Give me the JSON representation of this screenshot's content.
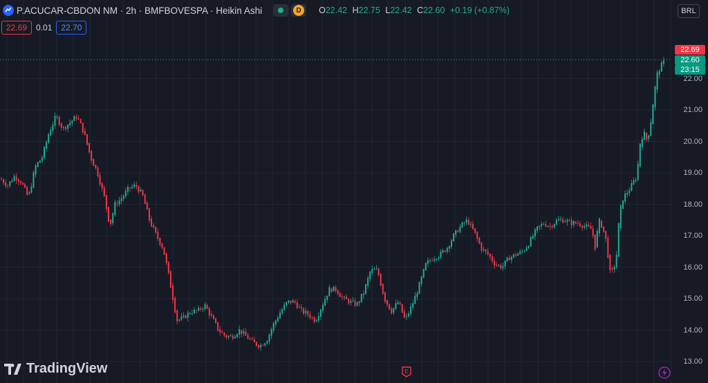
{
  "header": {
    "symbol": "P.ACUCAR-CBDON NM · 2h · BMFBOVESPA · Heikin Ashi",
    "badge_letter": "D",
    "ohlc": {
      "o_label": "O",
      "o": "22.42",
      "h_label": "H",
      "h": "22.75",
      "l_label": "L",
      "l": "22.42",
      "c_label": "C",
      "c": "22.60",
      "change": "+0.19 (+0.87%)"
    }
  },
  "order_row": {
    "sell": "22.69",
    "spread": "0.01",
    "buy": "22.70"
  },
  "currency": "BRL",
  "price_axis": {
    "ticks": [
      "22.00",
      "21.00",
      "20.00",
      "19.00",
      "18.00",
      "17.00",
      "16.00",
      "15.00",
      "14.00",
      "13.00"
    ],
    "tag_ask": "22.69",
    "tag_last": "22.60",
    "tag_countdown": "23:15"
  },
  "logo_text": "TradingView",
  "earnings_marker": "E",
  "colors": {
    "up": "#22ab94",
    "down": "#f23645",
    "background": "#161a25",
    "grid": "#232632"
  },
  "chart_data": {
    "type": "candlestick",
    "title": "",
    "ylim": [
      13.0,
      23.0
    ],
    "keypoints": [
      [
        0,
        18.8
      ],
      [
        10,
        18.6
      ],
      [
        20,
        18.9
      ],
      [
        30,
        18.7
      ],
      [
        40,
        18.2
      ],
      [
        50,
        19.2
      ],
      [
        60,
        19.5
      ],
      [
        70,
        20.3
      ],
      [
        80,
        20.8
      ],
      [
        90,
        20.4
      ],
      [
        100,
        20.6
      ],
      [
        110,
        20.8
      ],
      [
        120,
        20.3
      ],
      [
        130,
        19.5
      ],
      [
        140,
        19.0
      ],
      [
        150,
        18.2
      ],
      [
        158,
        17.3
      ],
      [
        165,
        18.0
      ],
      [
        175,
        18.2
      ],
      [
        185,
        18.5
      ],
      [
        195,
        18.6
      ],
      [
        205,
        18.3
      ],
      [
        215,
        17.5
      ],
      [
        225,
        17.0
      ],
      [
        235,
        16.6
      ],
      [
        245,
        15.5
      ],
      [
        255,
        14.3
      ],
      [
        265,
        14.4
      ],
      [
        275,
        14.6
      ],
      [
        285,
        14.6
      ],
      [
        295,
        14.8
      ],
      [
        305,
        14.4
      ],
      [
        315,
        14.0
      ],
      [
        325,
        13.8
      ],
      [
        335,
        13.8
      ],
      [
        345,
        14.0
      ],
      [
        355,
        13.8
      ],
      [
        365,
        13.6
      ],
      [
        375,
        13.5
      ],
      [
        385,
        13.7
      ],
      [
        395,
        14.2
      ],
      [
        405,
        14.6
      ],
      [
        415,
        14.9
      ],
      [
        425,
        14.9
      ],
      [
        435,
        14.6
      ],
      [
        445,
        14.5
      ],
      [
        455,
        14.3
      ],
      [
        465,
        14.8
      ],
      [
        475,
        15.3
      ],
      [
        485,
        15.3
      ],
      [
        495,
        15.0
      ],
      [
        505,
        14.9
      ],
      [
        515,
        14.8
      ],
      [
        525,
        15.2
      ],
      [
        535,
        15.9
      ],
      [
        545,
        15.9
      ],
      [
        555,
        15.0
      ],
      [
        565,
        14.6
      ],
      [
        575,
        14.9
      ],
      [
        585,
        14.3
      ],
      [
        595,
        14.8
      ],
      [
        605,
        15.4
      ],
      [
        615,
        16.1
      ],
      [
        625,
        16.3
      ],
      [
        635,
        16.4
      ],
      [
        645,
        16.6
      ],
      [
        655,
        17.0
      ],
      [
        665,
        17.3
      ],
      [
        675,
        17.5
      ],
      [
        685,
        17.1
      ],
      [
        695,
        16.6
      ],
      [
        705,
        16.4
      ],
      [
        715,
        16.1
      ],
      [
        725,
        16.0
      ],
      [
        735,
        16.3
      ],
      [
        745,
        16.4
      ],
      [
        755,
        16.5
      ],
      [
        765,
        16.8
      ],
      [
        775,
        17.2
      ],
      [
        785,
        17.4
      ],
      [
        795,
        17.3
      ],
      [
        805,
        17.5
      ],
      [
        815,
        17.5
      ],
      [
        825,
        17.4
      ],
      [
        835,
        17.4
      ],
      [
        845,
        17.3
      ],
      [
        855,
        17.2
      ],
      [
        860,
        16.6
      ],
      [
        865,
        17.5
      ],
      [
        870,
        17.3
      ],
      [
        876,
        16.8
      ],
      [
        882,
        15.7
      ],
      [
        890,
        16.2
      ],
      [
        895,
        17.7
      ],
      [
        900,
        18.2
      ],
      [
        910,
        18.5
      ],
      [
        920,
        18.9
      ],
      [
        925,
        20.0
      ],
      [
        930,
        20.3
      ],
      [
        935,
        20.0
      ],
      [
        940,
        20.6
      ],
      [
        945,
        21.5
      ],
      [
        950,
        22.2
      ],
      [
        955,
        22.4
      ],
      [
        962,
        22.6
      ]
    ]
  }
}
